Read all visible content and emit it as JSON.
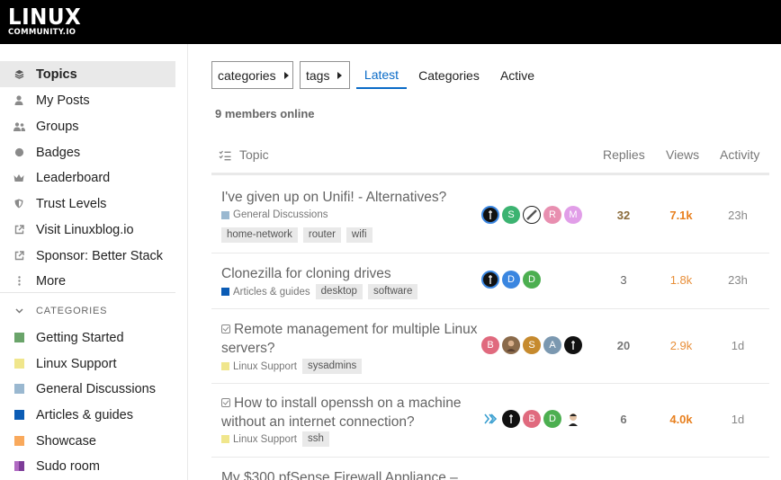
{
  "logo": {
    "main": "LINUX",
    "sub": "COMMUNITY.IO"
  },
  "sidebar": {
    "items": [
      {
        "label": "Topics",
        "icon": "layers-icon"
      },
      {
        "label": "My Posts",
        "icon": "user-icon"
      },
      {
        "label": "Groups",
        "icon": "users-icon"
      },
      {
        "label": "Badges",
        "icon": "certificate-icon"
      },
      {
        "label": "Leaderboard",
        "icon": "crown-icon"
      },
      {
        "label": "Trust Levels",
        "icon": "shield-icon"
      },
      {
        "label": "Visit Linuxblog.io",
        "icon": "external-link-icon"
      },
      {
        "label": "Sponsor: Better Stack",
        "icon": "external-link-icon"
      },
      {
        "label": "More",
        "icon": "ellipsis-vertical-icon"
      }
    ],
    "categories_heading": "CATEGORIES",
    "categories": [
      {
        "label": "Getting Started",
        "color": "#6aa46a"
      },
      {
        "label": "Linux Support",
        "color": "#f0e68c"
      },
      {
        "label": "General Discussions",
        "color": "#9ab8d0"
      },
      {
        "label": "Articles & guides",
        "color": "#0b5cb5"
      },
      {
        "label": "Showcase",
        "color": "#f9a95c"
      },
      {
        "label": "Sudo room",
        "color": "#7d3c98"
      }
    ]
  },
  "filters": {
    "categories_label": "categories",
    "tags_label": "tags",
    "tabs": [
      "Latest",
      "Categories",
      "Active"
    ],
    "active_tab": "Latest"
  },
  "members_online": "9 members online",
  "table": {
    "headers": {
      "topic": "Topic",
      "replies": "Replies",
      "views": "Views",
      "activity": "Activity"
    },
    "rows": [
      {
        "title": "I've given up on Unifi! - Alternatives?",
        "category": "General Discussions",
        "category_color": "#9ab8d0",
        "tags": [
          "home-network",
          "router",
          "wifi"
        ],
        "posters": [
          {
            "letter": "",
            "color": "#111"
          },
          {
            "letter": "S",
            "color": "#3cb371"
          },
          {
            "letter": "",
            "color": "#eee"
          },
          {
            "letter": "R",
            "color": "#e88fb0"
          },
          {
            "letter": "M",
            "color": "#e19ee8"
          }
        ],
        "replies": "32",
        "views": "7.1k",
        "views_color": "#e8801f",
        "activity": "23h"
      },
      {
        "title": "Clonezilla for cloning drives",
        "category": "Articles & guides",
        "category_color": "#0b5cb5",
        "tags": [
          "desktop",
          "software"
        ],
        "posters": [
          {
            "letter": "",
            "color": "#111"
          },
          {
            "letter": "D",
            "color": "#3a86e0"
          },
          {
            "letter": "D",
            "color": "#4caf50"
          }
        ],
        "replies": "3",
        "views": "1.8k",
        "views_color": "#e88f3a",
        "activity": "23h"
      },
      {
        "title": "Remote management for multiple Linux servers?",
        "category": "Linux Support",
        "category_color": "#f0e68c",
        "tags": [
          "sysadmins"
        ],
        "posters": [
          {
            "letter": "B",
            "color": "#e06a7e"
          },
          {
            "letter": "",
            "color": "#8a6a4a"
          },
          {
            "letter": "S",
            "color": "#c68a2e"
          },
          {
            "letter": "A",
            "color": "#7b98b0"
          },
          {
            "letter": "",
            "color": "#111"
          }
        ],
        "replies": "20",
        "views": "2.9k",
        "views_color": "#e88f3a",
        "activity": "1d"
      },
      {
        "title": "How to install openssh on a machine without an internet connection?",
        "category": "Linux Support",
        "category_color": "#f0e68c",
        "tags": [
          "ssh"
        ],
        "posters": [
          {
            "letter": "",
            "color": "#fff"
          },
          {
            "letter": "",
            "color": "#111"
          },
          {
            "letter": "B",
            "color": "#e06a7e"
          },
          {
            "letter": "D",
            "color": "#4caf50"
          },
          {
            "letter": "",
            "color": "#fff"
          }
        ],
        "replies": "6",
        "views": "4.0k",
        "views_color": "#e8801f",
        "activity": "1d"
      },
      {
        "title": "My $300 pfSense Firewall Appliance –"
      }
    ]
  }
}
